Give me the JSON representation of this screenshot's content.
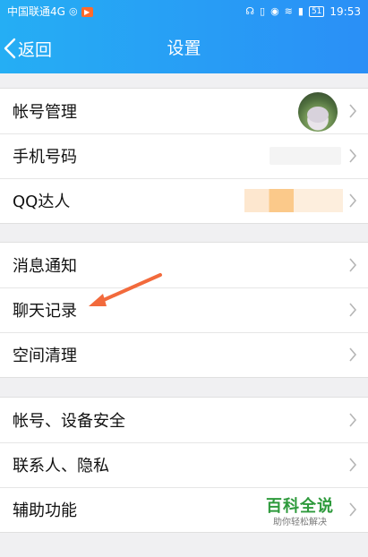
{
  "status_bar": {
    "carrier": "中国联通4G",
    "battery": "51",
    "time": "19:53"
  },
  "nav": {
    "back_label": "返回",
    "title": "设置"
  },
  "groups": [
    {
      "rows": [
        {
          "label": "帐号管理"
        },
        {
          "label": "手机号码"
        },
        {
          "label": "QQ达人"
        }
      ]
    },
    {
      "rows": [
        {
          "label": "消息通知"
        },
        {
          "label": "聊天记录"
        },
        {
          "label": "空间清理"
        }
      ]
    },
    {
      "rows": [
        {
          "label": "帐号、设备安全"
        },
        {
          "label": "联系人、隐私"
        },
        {
          "label": "辅助功能"
        }
      ]
    }
  ],
  "watermark": {
    "main": "百科全说",
    "sub": "助你轻松解决"
  },
  "colors": {
    "header_start": "#25aef4",
    "header_end": "#2a8ff6",
    "annotation_arrow": "#f26a3c"
  }
}
